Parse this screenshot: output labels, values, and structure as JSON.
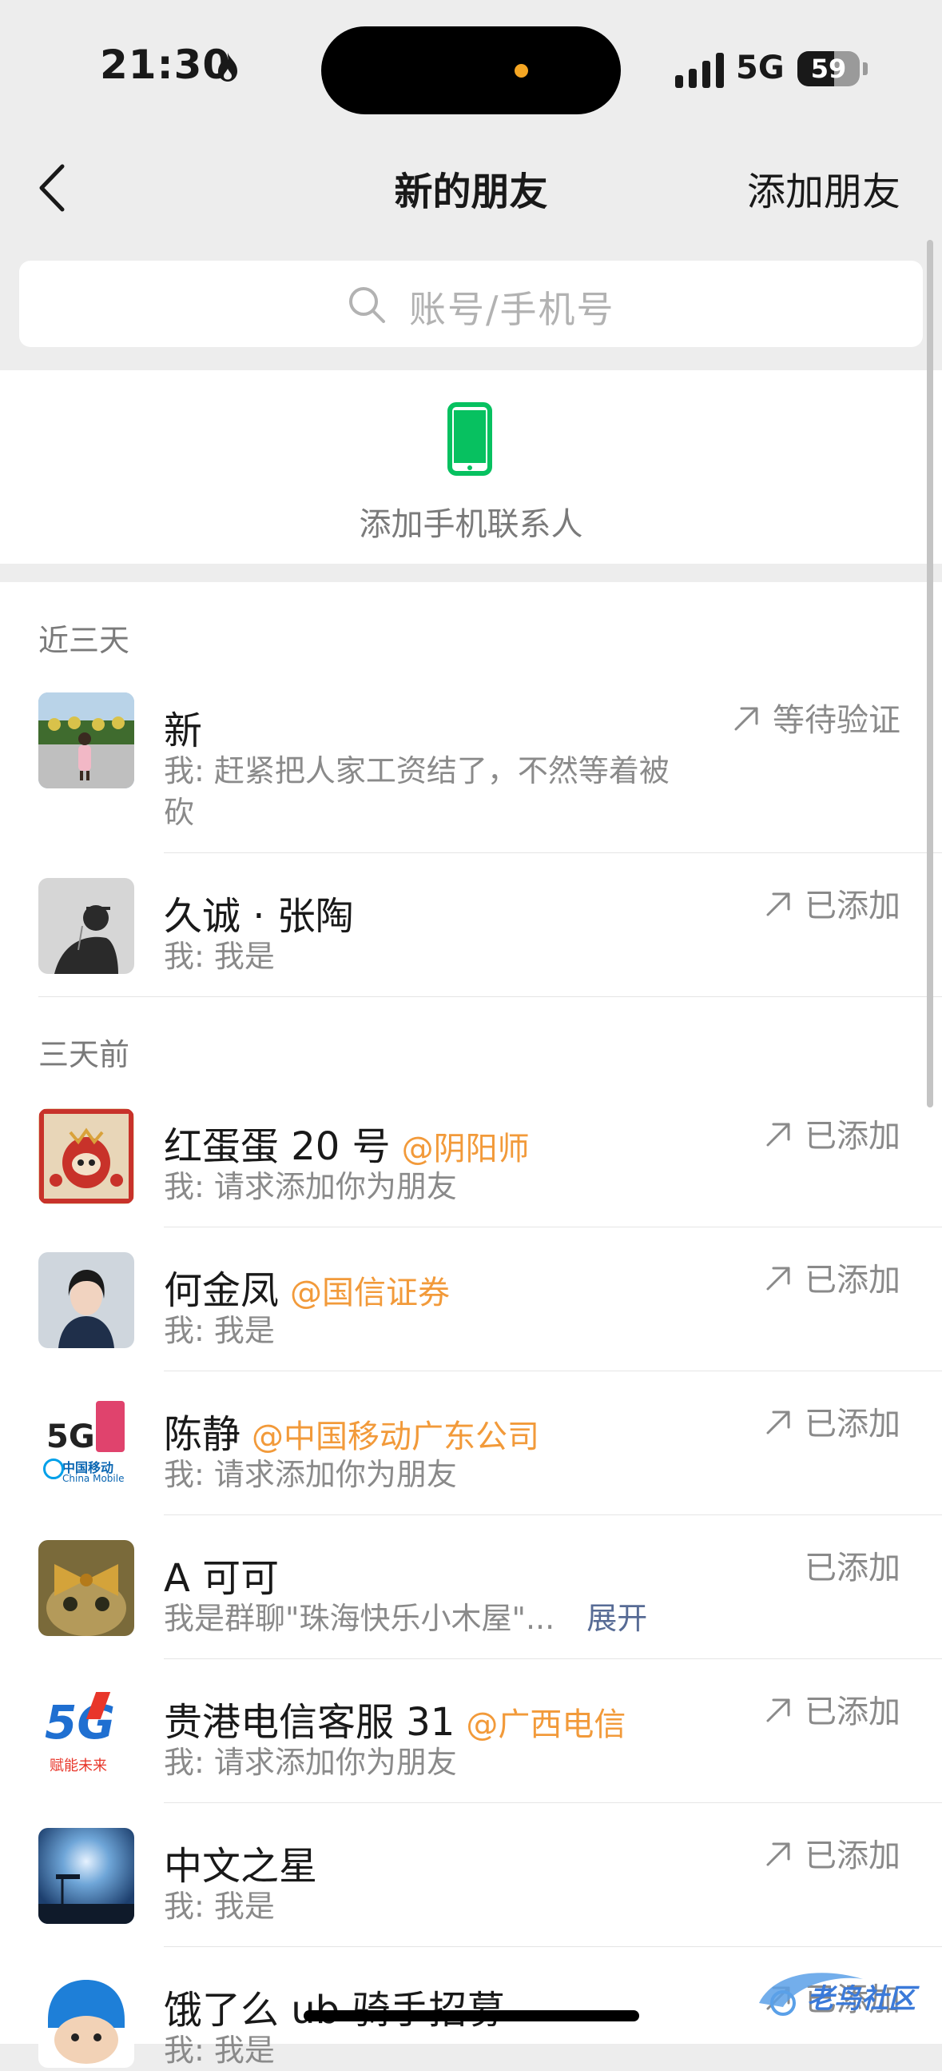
{
  "status_bar": {
    "time": "21:30",
    "network": "5G",
    "battery": "59",
    "battery_level": 0.59
  },
  "nav": {
    "title": "新的朋友",
    "action": "添加朋友",
    "back_icon": "chevron-left-icon"
  },
  "search": {
    "placeholder": "账号/手机号",
    "icon": "search-icon"
  },
  "phone_contacts": {
    "label": "添加手机联系人",
    "icon": "phone-icon",
    "icon_color": "#07c160"
  },
  "sections": [
    {
      "header": "近三天",
      "items": [
        {
          "name": "新",
          "org": "",
          "message": "我: 赶紧把人家工资结了，不然等着被砍",
          "status": "等待验证",
          "arrow": true
        },
        {
          "name": "久诚 · 张陶",
          "org": "",
          "message": "我: 我是",
          "status": "已添加",
          "arrow": true
        }
      ]
    },
    {
      "header": "三天前",
      "items": [
        {
          "name": "红蛋蛋 20 号",
          "org": "@阴阳师",
          "message": "我: 请求添加你为朋友",
          "status": "已添加",
          "arrow": true
        },
        {
          "name": "何金凤",
          "org": "@国信证券",
          "message": "我: 我是",
          "status": "已添加",
          "arrow": true
        },
        {
          "name": "陈静",
          "org": "@中国移动广东公司",
          "message": "我: 请求添加你为朋友",
          "status": "已添加",
          "arrow": true
        },
        {
          "name": "A 可可",
          "org": "",
          "message": "我是群聊\"珠海快乐小木屋\"...",
          "expand": "展开",
          "status": "已添加",
          "arrow": false
        },
        {
          "name": "贵港电信客服 31",
          "org": "@广西电信",
          "message": "我: 请求添加你为朋友",
          "status": "已添加",
          "arrow": true
        },
        {
          "name": "中文之星",
          "org": "",
          "message": "我: 我是",
          "status": "已添加",
          "arrow": true
        },
        {
          "name": "饿了么 ub 骑手招募",
          "org": "",
          "message": "我: 我是",
          "status": "已添加",
          "arrow": true
        }
      ]
    }
  ],
  "avatar_texts": {
    "mobile_5g": "5G",
    "china_mobile_cn": "中国移动",
    "china_mobile_en": "China Mobile",
    "telecom_slogan": "赋能未来"
  },
  "watermark": "老鸟社区",
  "colors": {
    "org": "#f29a3a",
    "expand": "#576b95",
    "background": "#ededed"
  }
}
